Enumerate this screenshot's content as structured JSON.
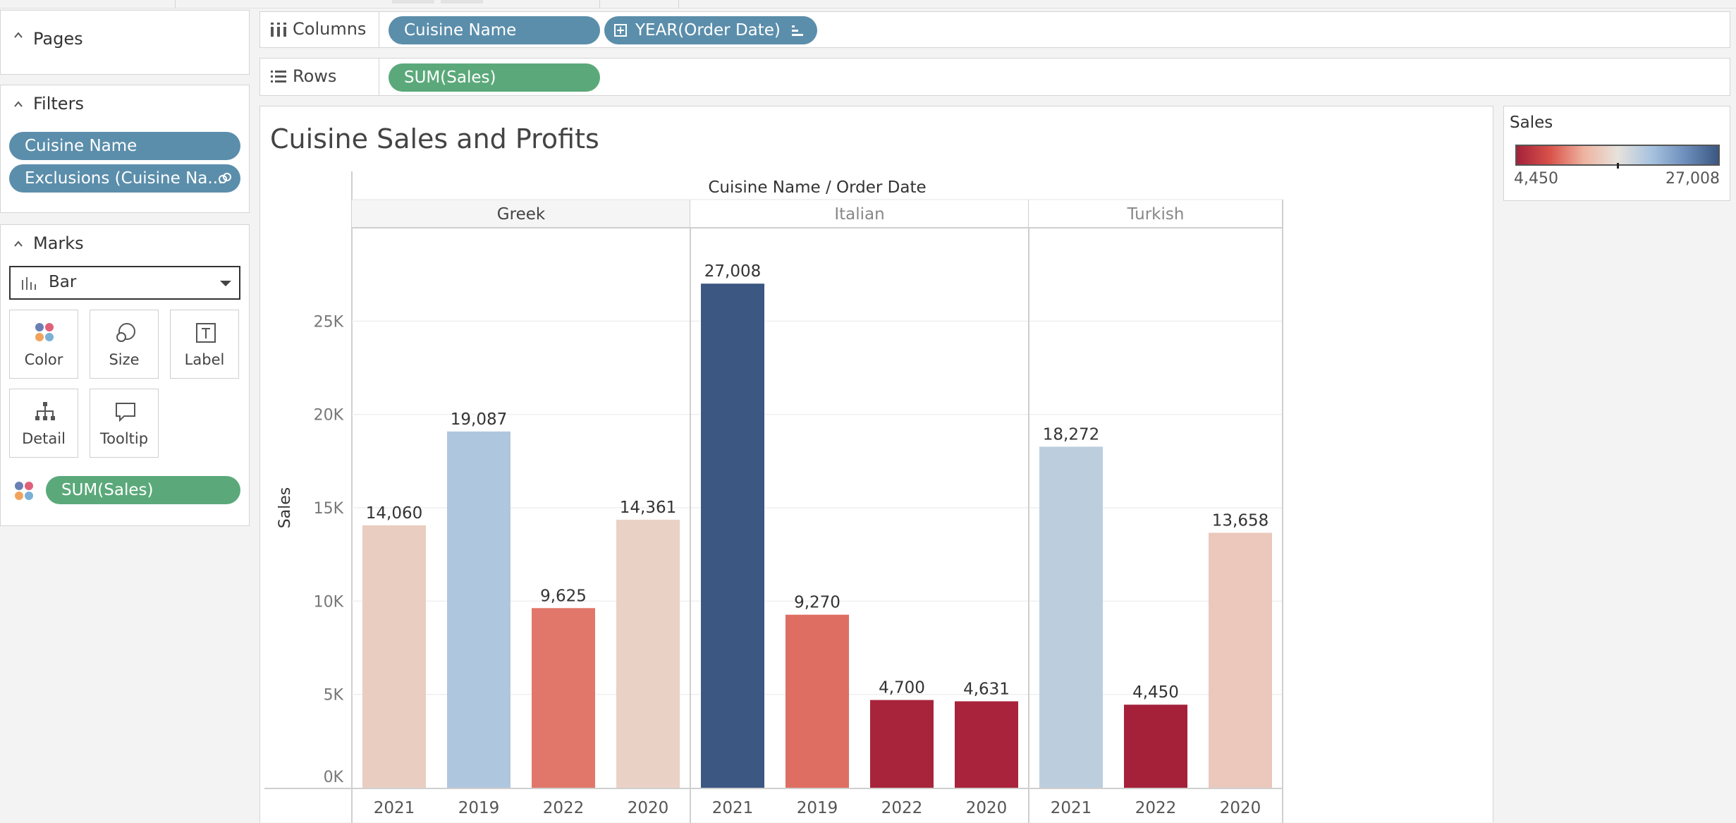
{
  "left_panel": {
    "pages": {
      "title": "Pages"
    },
    "filters": {
      "title": "Filters",
      "pills": [
        "Cuisine Name",
        "Exclusions (Cuisine Na..."
      ]
    },
    "marks": {
      "title": "Marks",
      "mark_type": "Bar",
      "buttons": {
        "color": "Color",
        "size": "Size",
        "label": "Label",
        "detail": "Detail",
        "tooltip": "Tooltip"
      },
      "color_field": "SUM(Sales)"
    }
  },
  "shelves": {
    "columns": {
      "label": "Columns",
      "pills": [
        "Cuisine Name",
        "YEAR(Order Date)"
      ]
    },
    "rows": {
      "label": "Rows",
      "pills": [
        "SUM(Sales)"
      ]
    }
  },
  "legend": {
    "title": "Sales",
    "min_label": "4,450",
    "max_label": "27,008",
    "min_value": 4450,
    "max_value": 27008,
    "colors": [
      "#a5213a",
      "#d9534a",
      "#eeb3a0",
      "#e7e2dc",
      "#a8c3df",
      "#6e8fbc",
      "#3b5782"
    ]
  },
  "chart_data": {
    "type": "bar",
    "title": "Cuisine Sales and Profits",
    "header": "Cuisine Name / Order Date",
    "ylabel": "Sales",
    "ylim": [
      0,
      30000
    ],
    "yticks": [
      0,
      5000,
      10000,
      15000,
      20000,
      25000
    ],
    "ytick_labels": [
      "0K",
      "5K",
      "10K",
      "15K",
      "20K",
      "25K"
    ],
    "groups": [
      {
        "name": "Greek",
        "categories": [
          "2021",
          "2019",
          "2022",
          "2020"
        ],
        "values": [
          14060,
          19087,
          9625,
          14361
        ],
        "labels": [
          "14,060",
          "19,087",
          "9,625",
          "14,361"
        ]
      },
      {
        "name": "Italian",
        "categories": [
          "2021",
          "2019",
          "2022",
          "2020"
        ],
        "values": [
          27008,
          9270,
          4700,
          4631
        ],
        "labels": [
          "27,008",
          "9,270",
          "4,700",
          "4,631"
        ]
      },
      {
        "name": "Turkish",
        "categories": [
          "2021",
          "2022",
          "2020"
        ],
        "values": [
          18272,
          4450,
          13658
        ],
        "labels": [
          "18,272",
          "4,450",
          "13,658"
        ]
      }
    ]
  }
}
